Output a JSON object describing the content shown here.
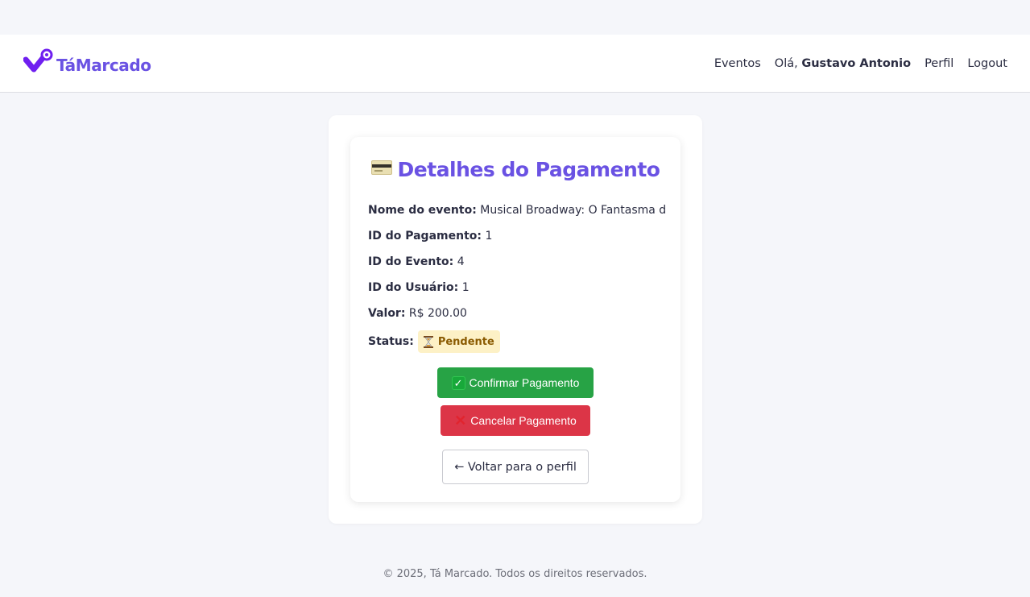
{
  "brand": {
    "name": "TáMarcado",
    "icon": "check-pin-icon",
    "color": "#6a52e3"
  },
  "nav": {
    "events": "Eventos",
    "greeting_prefix": "Olá, ",
    "user_name": "Gustavo Antonio",
    "profile": "Perfil",
    "logout": "Logout"
  },
  "payment": {
    "title": "Detalhes do Pagamento",
    "title_icon": "credit-card-icon",
    "fields": {
      "event_name_label": "Nome do evento:",
      "event_name": "Musical Broadway: O Fantasma d",
      "payment_id_label": "ID do Pagamento:",
      "payment_id": "1",
      "event_id_label": "ID do Evento:",
      "event_id": "4",
      "user_id_label": "ID do Usuário:",
      "user_id": "1",
      "value_label": "Valor:",
      "value": "R$ 200.00",
      "status_label": "Status:",
      "status": "Pendente",
      "status_icon": "hourglass-icon"
    },
    "actions": {
      "confirm": "Confirmar Pagamento",
      "cancel": "Cancelar Pagamento",
      "back": "← Voltar para o perfil"
    }
  },
  "colors": {
    "accent": "#6a52e3",
    "confirm": "#27a345",
    "cancel": "#dc3547",
    "pending_bg": "#fdf1c6",
    "pending_text": "#8a5a00"
  },
  "footer": {
    "text": "© 2025, Tá Marcado. Todos os direitos reservados."
  }
}
